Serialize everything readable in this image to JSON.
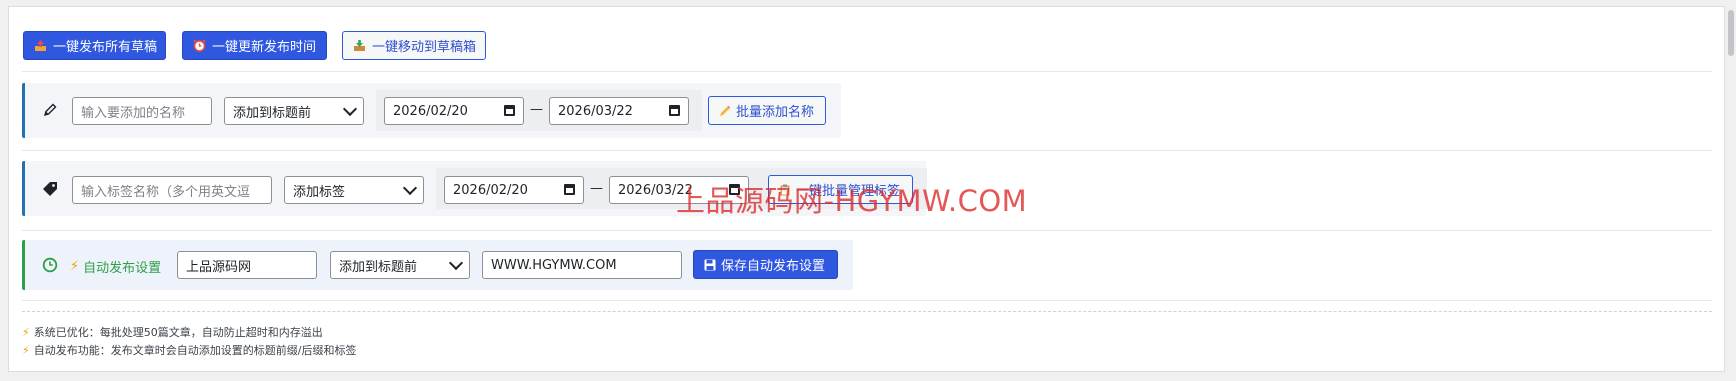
{
  "toolbar": {
    "publish_all_drafts": "一键发布所有草稿",
    "update_publish_time": "一键更新发布时间",
    "move_to_drafts": "一键移动到草稿箱"
  },
  "name_row": {
    "name_placeholder": "输入要添加的名称",
    "position_select": "添加到标题前",
    "date_start": "2026/02/20",
    "date_end": "2026/03/22",
    "date_separator": "—",
    "batch_add_button": "批量添加名称"
  },
  "tag_row": {
    "tag_placeholder": "输入标签名称（多个用英文逗",
    "action_select": "添加标签",
    "date_start": "2026/02/20",
    "date_end": "2026/03/22",
    "date_separator": "—",
    "batch_manage_button": "一键批量管理标签"
  },
  "auto_row": {
    "label": "自动发布设置",
    "name_value": "上品源码网",
    "position_select": "添加到标题前",
    "suffix_value": "WWW.HGYMW.COM",
    "save_button": "保存自动发布设置"
  },
  "notes": [
    "系统已优化：每批处理50篇文章，自动防止超时和内存溢出",
    "自动发布功能：发布文章时会自动添加设置的标题前缀/后缀和标签"
  ],
  "watermark": "上品源码网-HGYMW.COM",
  "colors": {
    "primary": "#2f57e0",
    "accent_bar_blue": "#2271b1",
    "accent_bar_green": "#2e9e47",
    "note_bolt": "#f0a300",
    "watermark": "#dc2828"
  },
  "icons": [
    "upload-tray-icon",
    "alarm-clock-icon",
    "download-tray-icon",
    "pencil-icon",
    "tag-icon",
    "clock-icon",
    "bolt-icon",
    "floppy-disk-icon",
    "calendar-icon",
    "chevron-down-icon"
  ]
}
